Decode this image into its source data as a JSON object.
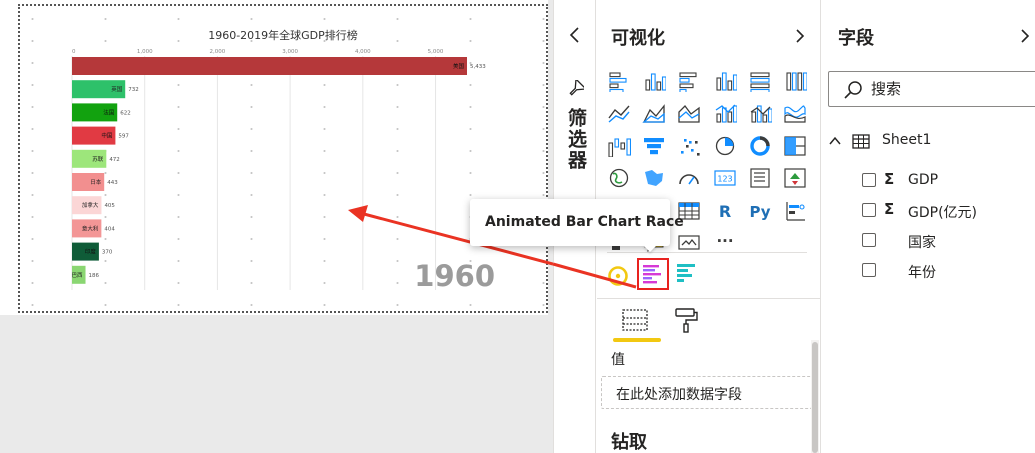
{
  "chart_data": {
    "type": "bar",
    "title": "1960-2019年全球GDP排行榜",
    "orientation": "horizontal",
    "categories": [
      "美国",
      "英国",
      "法国",
      "中国",
      "苏联",
      "日本",
      "加拿大",
      "意大利",
      "印度",
      "巴西"
    ],
    "values": [
      5433,
      732,
      622,
      597,
      472,
      443,
      405,
      404,
      370,
      186
    ],
    "value_labels": [
      "5,433",
      "732",
      "622",
      "597",
      "472",
      "443",
      "405",
      "404",
      "370",
      "186"
    ],
    "colors": [
      "#b5383a",
      "#2ec16a",
      "#12a20f",
      "#e13a43",
      "#9de67b",
      "#f28f8f",
      "#fbd6d6",
      "#f39696",
      "#0f5c38",
      "#8ad672"
    ],
    "xaxis_ticks": [
      "0",
      "1,000",
      "2,000",
      "3,000",
      "4,000",
      "5,000"
    ],
    "xlim": [
      0,
      5500
    ],
    "grid": true,
    "watermark_year": "1960"
  },
  "filters": {
    "label": "筛选器"
  },
  "visualizations": {
    "title": "可视化",
    "icons": [
      "stacked-bar-chart-icon",
      "stacked-column-chart-icon",
      "clustered-bar-chart-icon",
      "clustered-column-chart-icon",
      "100-stacked-bar-chart-icon",
      "100-stacked-column-chart-icon",
      "line-chart-icon",
      "area-chart-icon",
      "stacked-area-chart-icon",
      "line-and-column-chart-icon",
      "line-and-clustered-column-chart-icon",
      "ribbon-chart-icon",
      "waterfall-chart-icon",
      "funnel-chart-icon",
      "scatter-chart-icon",
      "pie-chart-icon",
      "donut-chart-icon",
      "treemap-icon",
      "map-icon",
      "filled-map-icon",
      "gauge-icon",
      "card-icon",
      "multi-row-card-icon",
      "kpi-icon",
      "slicer-icon",
      "table-visual-icon",
      "matrix-icon",
      "r-visual-icon",
      "python-visual-icon",
      "key-influencers-icon",
      "decomposition-tree-icon",
      "qa-visual-icon",
      "smart-narrative-icon",
      "paginated-report-icon",
      "power-apps-icon",
      "more-visuals-icon"
    ],
    "r_label": "R",
    "py_label": "Py",
    "more_label": "···",
    "custom_icons": [
      "gauge-ring-icon",
      "animated-bar-chart-race-icon",
      "horizontal-bar-icon"
    ],
    "tooltip": "Animated Bar Chart Race",
    "value_label": "值",
    "value_well_placeholder": "在此处添加数据字段",
    "drill_title": "钻取"
  },
  "fields": {
    "title": "字段",
    "search_placeholder": "搜索",
    "table_name": "Sheet1",
    "items": [
      {
        "name": "GDP",
        "sigma": "Σ"
      },
      {
        "name": "GDP(亿元)",
        "sigma": "Σ"
      },
      {
        "name": "国家",
        "sigma": ""
      },
      {
        "name": "年份",
        "sigma": ""
      }
    ]
  },
  "colors": {
    "accent_yellow": "#f2c811",
    "highlight_red": "#e8221f",
    "arrow_red": "#ea3323",
    "icon_blue": "#118dff",
    "icon_dark": "#3c3c3b"
  }
}
